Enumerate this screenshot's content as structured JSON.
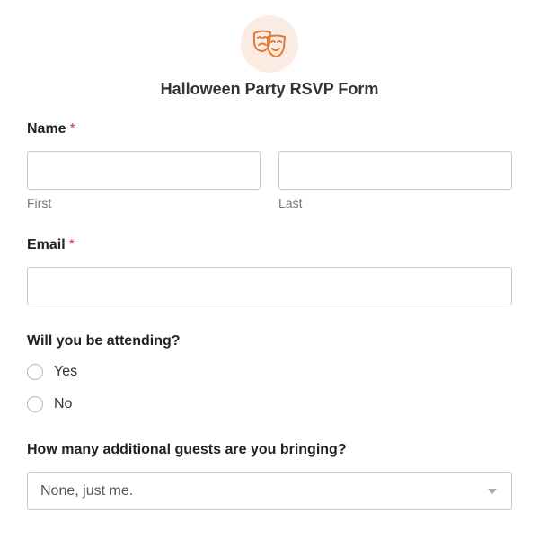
{
  "form": {
    "title": "Halloween Party RSVP Form",
    "logo_icon": "theater-masks-icon",
    "accent_color": "#e07b39",
    "logo_bg_color": "#fbece3",
    "required_color": "#d63637"
  },
  "fields": {
    "name": {
      "label": "Name",
      "required_marker": "*",
      "first_value": "",
      "first_sublabel": "First",
      "last_value": "",
      "last_sublabel": "Last"
    },
    "email": {
      "label": "Email",
      "required_marker": "*",
      "value": ""
    },
    "attending": {
      "label": "Will you be attending?",
      "options": [
        "Yes",
        "No"
      ],
      "selected": null
    },
    "guests": {
      "label": "How many additional guests are you bringing?",
      "selected_value": "None, just me."
    }
  }
}
